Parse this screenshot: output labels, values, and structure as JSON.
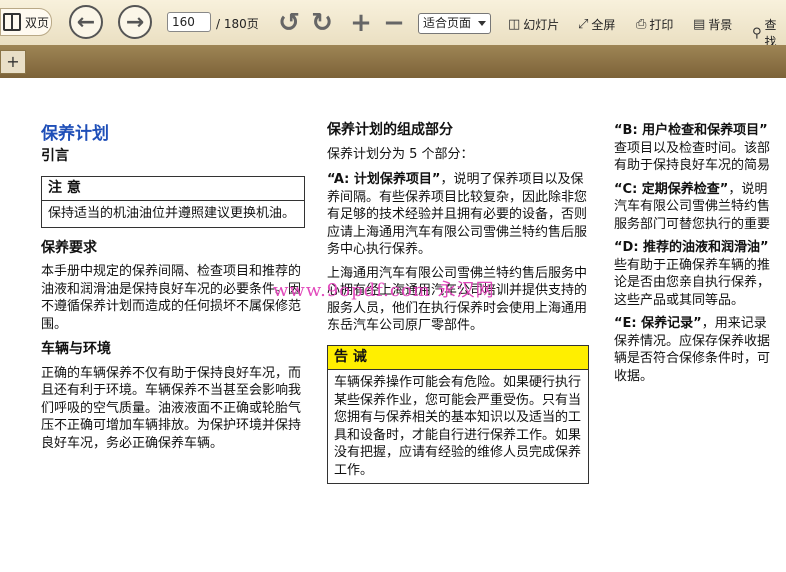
{
  "toolbar": {
    "double_page_label": "双页",
    "current_page": "160",
    "total_pages": "/ 180页",
    "fit_select": "适合页面",
    "slideshow": "幻灯片",
    "fullscreen": "全屏",
    "print": "打印",
    "background": "背景",
    "search": "查找"
  },
  "tabs": {
    "add": "+"
  },
  "document": {
    "col1": {
      "title": "保养计划",
      "intro": "引言",
      "note_title": "注 意",
      "note_body": "保持适当的机油油位并遵照建议更换机油。",
      "req_heading": "保养要求",
      "req_body": "本手册中规定的保养间隔、检查项目和推荐的油液和润滑油是保持良好车况的必要条件。因不遵循保养计划而造成的任何损坏不属保修范围。",
      "env_heading": "车辆与环境",
      "env_body": "正确的车辆保养不仅有助于保持良好车况，而且还有利于环境。车辆保养不当甚至会影响我们呼吸的空气质量。油液液面不正确或轮胎气压不正确可增加车辆排放。为保护环境并保持良好车况，务必正确保养车辆。"
    },
    "col2": {
      "heading": "保养计划的组成部分",
      "intro": "保养计划分为 5 个部分：",
      "a_label": "“A: 计划保养项目”",
      "a_body": "，说明了保养项目以及保养间隔。有些保养项目比较复杂，因此除非您有足够的技术经验并且拥有必要的设备，否则应请上海通用汽车有限公司雪佛兰特约售后服务中心执行保养。",
      "p2": "上海通用汽车有限公司雪佛兰特约售后服务中心拥有经上海通用汽车公司培训并提供支持的服务人员，他们在执行保养时会使用上海通用东岳汽车公司原厂零部件。",
      "warn_title": "告 诫",
      "warn_body": "车辆保养操作可能会有危险。如果硬行执行某些保养作业，您可能会严重受伤。只有当您拥有与保养相关的基本知识以及适当的工具和设备时，才能自行进行保养工作。如果没有把握，应请有经验的维修人员完成保养工作。"
    },
    "col3": {
      "b_label": "“B: 用户检查和保养项目”",
      "b_line1": "查项目以及检查时间。该部",
      "b_line2": "有助于保持良好车况的简易",
      "c_label": "“C: 定期保养检查”",
      "c_tail": "，说明",
      "c_line1": "汽车有限公司雪佛兰特约售",
      "c_line2": "服务部门可替您执行的重要",
      "d_label": "“D: 推荐的油液和润滑油”",
      "d_line1": "些有助于正确保养车辆的推",
      "d_line2": "论是否由您亲自执行保养，",
      "d_line3": "这些产品或其同等品。",
      "e_label": "“E: 保养记录”",
      "e_tail": "，用来记录",
      "e_line1": "保养情况。应保存保养收据",
      "e_line2": "辆是否符合保修条件时，可",
      "e_line3": "收据。"
    },
    "watermark": "www.9opdf.com 永汉网"
  }
}
